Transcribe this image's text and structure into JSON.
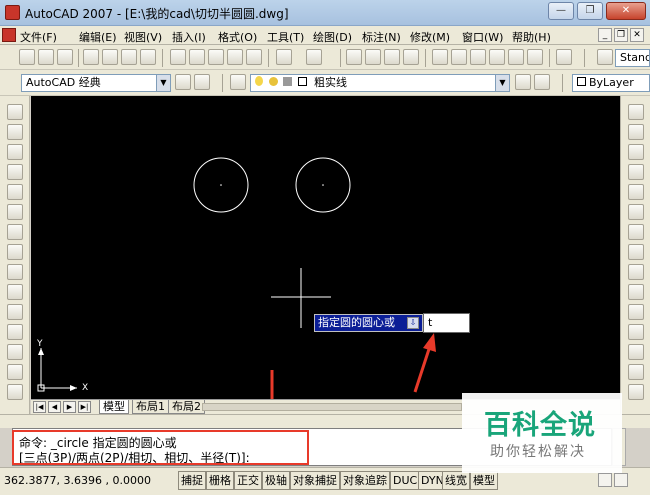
{
  "window": {
    "title": "AutoCAD 2007 - [E:\\我的cad\\切切半圆圆.dwg]",
    "minimize_glyph": "—",
    "restore_glyph": "❐",
    "close_glyph": "✕"
  },
  "menu": {
    "items": [
      "文件(F)",
      "编辑(E)",
      "视图(V)",
      "插入(I)",
      "格式(O)",
      "工具(T)",
      "绘图(D)",
      "标注(N)",
      "修改(M)",
      "窗口(W)",
      "帮助(H)"
    ],
    "mdi_minimize": "_",
    "mdi_restore": "❐",
    "mdi_close": "✕"
  },
  "toolbar1": {
    "style_combo": "Stand"
  },
  "toolbar2": {
    "workspace": "AutoCAD 经典",
    "layer": "粗实线",
    "color": "ByLayer"
  },
  "canvas": {
    "ucs_y": "Y",
    "ucs_x": "X",
    "dyn_prompt": "指定圆的圆心或",
    "dyn_lock": "⇩",
    "dyn_input_value": "t"
  },
  "tabs": {
    "model": "模型",
    "layout1": "布局1",
    "layout2": "布局2",
    "nav": [
      "|◀",
      "◀",
      "▶",
      "▶|"
    ]
  },
  "command": {
    "line1": "命令: _circle 指定圆的圆心或",
    "line2": "[三点(3P)/两点(2P)/相切、相切、半径(T)]:"
  },
  "status": {
    "coords": "362.3877, 3.6396 , 0.0000",
    "buttons": [
      "捕捉",
      "栅格",
      "正交",
      "极轴",
      "对象捕捉",
      "对象追踪",
      "DUCS",
      "DYN",
      "线宽",
      "模型"
    ]
  },
  "watermark": {
    "brand": "百科全说",
    "slogan": "助你轻松解决"
  },
  "colors": {
    "annotation": "#e83a2a",
    "brand": "#19a57a",
    "canvas": "#000000",
    "dyn_prompt_bg": "#0b1e96"
  }
}
